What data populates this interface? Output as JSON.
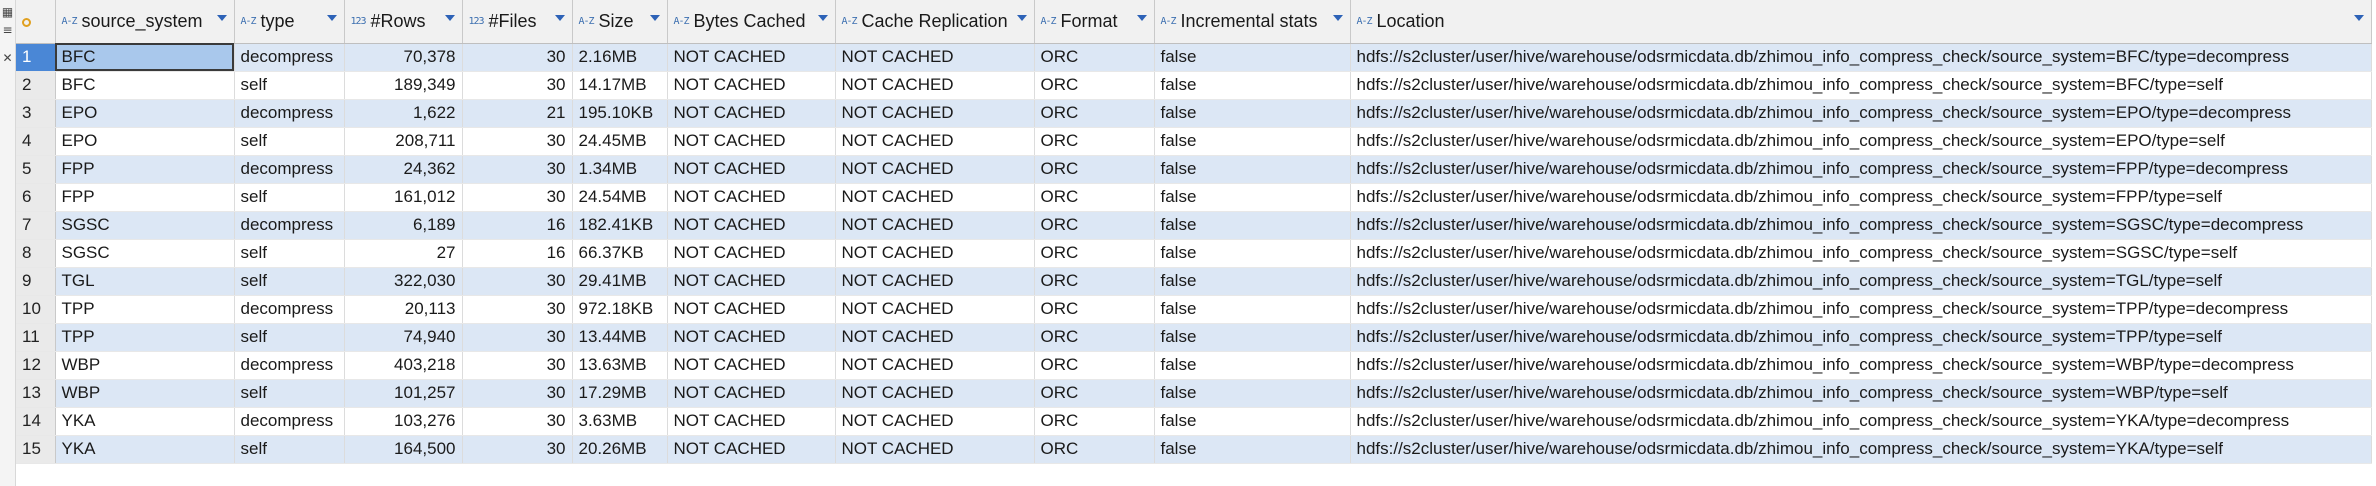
{
  "side_toolbar": {
    "icons": [
      "grid-icon",
      "text-icon",
      "close-icon"
    ],
    "glyphs": [
      "▦",
      "≡",
      "✕"
    ]
  },
  "columns": [
    {
      "key": "source_system",
      "label": "source_system",
      "type_icon": "A-Z"
    },
    {
      "key": "type",
      "label": "type",
      "type_icon": "A-Z"
    },
    {
      "key": "rows",
      "label": "#Rows",
      "type_icon": "123"
    },
    {
      "key": "files",
      "label": "#Files",
      "type_icon": "123"
    },
    {
      "key": "size",
      "label": "Size",
      "type_icon": "A-Z"
    },
    {
      "key": "bytes_cached",
      "label": "Bytes Cached",
      "type_icon": "A-Z"
    },
    {
      "key": "cache_replication",
      "label": "Cache Replication",
      "type_icon": "A-Z"
    },
    {
      "key": "format",
      "label": "Format",
      "type_icon": "A-Z"
    },
    {
      "key": "incremental_stats",
      "label": "Incremental stats",
      "type_icon": "A-Z"
    },
    {
      "key": "location",
      "label": "Location",
      "type_icon": "A-Z"
    }
  ],
  "rows": [
    [
      "1",
      "BFC",
      "decompress",
      "70,378",
      "30",
      "2.16MB",
      "NOT CACHED",
      "NOT CACHED",
      "ORC",
      "false",
      "hdfs://s2cluster/user/hive/warehouse/odsrmicdata.db/zhimou_info_compress_check/source_system=BFC/type=decompress"
    ],
    [
      "2",
      "BFC",
      "self",
      "189,349",
      "30",
      "14.17MB",
      "NOT CACHED",
      "NOT CACHED",
      "ORC",
      "false",
      "hdfs://s2cluster/user/hive/warehouse/odsrmicdata.db/zhimou_info_compress_check/source_system=BFC/type=self"
    ],
    [
      "3",
      "EPO",
      "decompress",
      "1,622",
      "21",
      "195.10KB",
      "NOT CACHED",
      "NOT CACHED",
      "ORC",
      "false",
      "hdfs://s2cluster/user/hive/warehouse/odsrmicdata.db/zhimou_info_compress_check/source_system=EPO/type=decompress"
    ],
    [
      "4",
      "EPO",
      "self",
      "208,711",
      "30",
      "24.45MB",
      "NOT CACHED",
      "NOT CACHED",
      "ORC",
      "false",
      "hdfs://s2cluster/user/hive/warehouse/odsrmicdata.db/zhimou_info_compress_check/source_system=EPO/type=self"
    ],
    [
      "5",
      "FPP",
      "decompress",
      "24,362",
      "30",
      "1.34MB",
      "NOT CACHED",
      "NOT CACHED",
      "ORC",
      "false",
      "hdfs://s2cluster/user/hive/warehouse/odsrmicdata.db/zhimou_info_compress_check/source_system=FPP/type=decompress"
    ],
    [
      "6",
      "FPP",
      "self",
      "161,012",
      "30",
      "24.54MB",
      "NOT CACHED",
      "NOT CACHED",
      "ORC",
      "false",
      "hdfs://s2cluster/user/hive/warehouse/odsrmicdata.db/zhimou_info_compress_check/source_system=FPP/type=self"
    ],
    [
      "7",
      "SGSC",
      "decompress",
      "6,189",
      "16",
      "182.41KB",
      "NOT CACHED",
      "NOT CACHED",
      "ORC",
      "false",
      "hdfs://s2cluster/user/hive/warehouse/odsrmicdata.db/zhimou_info_compress_check/source_system=SGSC/type=decompress"
    ],
    [
      "8",
      "SGSC",
      "self",
      "27",
      "16",
      "66.37KB",
      "NOT CACHED",
      "NOT CACHED",
      "ORC",
      "false",
      "hdfs://s2cluster/user/hive/warehouse/odsrmicdata.db/zhimou_info_compress_check/source_system=SGSC/type=self"
    ],
    [
      "9",
      "TGL",
      "self",
      "322,030",
      "30",
      "29.41MB",
      "NOT CACHED",
      "NOT CACHED",
      "ORC",
      "false",
      "hdfs://s2cluster/user/hive/warehouse/odsrmicdata.db/zhimou_info_compress_check/source_system=TGL/type=self"
    ],
    [
      "10",
      "TPP",
      "decompress",
      "20,113",
      "30",
      "972.18KB",
      "NOT CACHED",
      "NOT CACHED",
      "ORC",
      "false",
      "hdfs://s2cluster/user/hive/warehouse/odsrmicdata.db/zhimou_info_compress_check/source_system=TPP/type=decompress"
    ],
    [
      "11",
      "TPP",
      "self",
      "74,940",
      "30",
      "13.44MB",
      "NOT CACHED",
      "NOT CACHED",
      "ORC",
      "false",
      "hdfs://s2cluster/user/hive/warehouse/odsrmicdata.db/zhimou_info_compress_check/source_system=TPP/type=self"
    ],
    [
      "12",
      "WBP",
      "decompress",
      "403,218",
      "30",
      "13.63MB",
      "NOT CACHED",
      "NOT CACHED",
      "ORC",
      "false",
      "hdfs://s2cluster/user/hive/warehouse/odsrmicdata.db/zhimou_info_compress_check/source_system=WBP/type=decompress"
    ],
    [
      "13",
      "WBP",
      "self",
      "101,257",
      "30",
      "17.29MB",
      "NOT CACHED",
      "NOT CACHED",
      "ORC",
      "false",
      "hdfs://s2cluster/user/hive/warehouse/odsrmicdata.db/zhimou_info_compress_check/source_system=WBP/type=self"
    ],
    [
      "14",
      "YKA",
      "decompress",
      "103,276",
      "30",
      "3.63MB",
      "NOT CACHED",
      "NOT CACHED",
      "ORC",
      "false",
      "hdfs://s2cluster/user/hive/warehouse/odsrmicdata.db/zhimou_info_compress_check/source_system=YKA/type=decompress"
    ],
    [
      "15",
      "YKA",
      "self",
      "164,500",
      "30",
      "20.26MB",
      "NOT CACHED",
      "NOT CACHED",
      "ORC",
      "false",
      "hdfs://s2cluster/user/hive/warehouse/odsrmicdata.db/zhimou_info_compress_check/source_system=YKA/type=self"
    ]
  ],
  "selection": {
    "row": 0,
    "column": 0
  },
  "colors": {
    "stripe": "#dce7f5",
    "selected_row_number": "#4a87d6",
    "header": "#f1f1f1",
    "sort_arrow": "#2d62b7"
  }
}
